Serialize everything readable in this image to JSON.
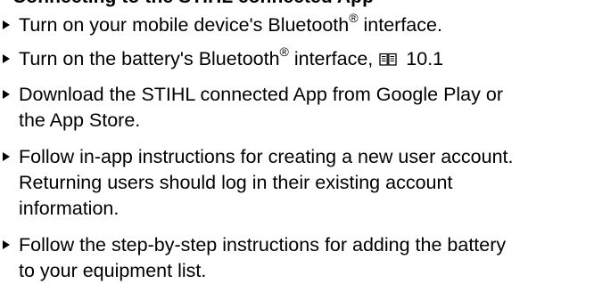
{
  "heading": "Connecting to the STIHL connected App",
  "items": [
    {
      "before": "Turn on your mobile device's Bluetooth",
      "sup": "®",
      "after": " interface."
    },
    {
      "before": "Turn on the battery's Bluetooth",
      "sup": "®",
      "after": " interface,",
      "icon": "book-reference-icon",
      "ref": "10.1"
    },
    {
      "lines": [
        "Download the STIHL connected App from Google Play or",
        "the App Store."
      ]
    },
    {
      "lines": [
        "Follow in-app instructions for creating a new user account.",
        "Returning users should log in their existing account",
        "information."
      ]
    },
    {
      "lines": [
        "Follow the step-by-step instructions for adding the battery",
        "to your equipment list."
      ]
    }
  ]
}
